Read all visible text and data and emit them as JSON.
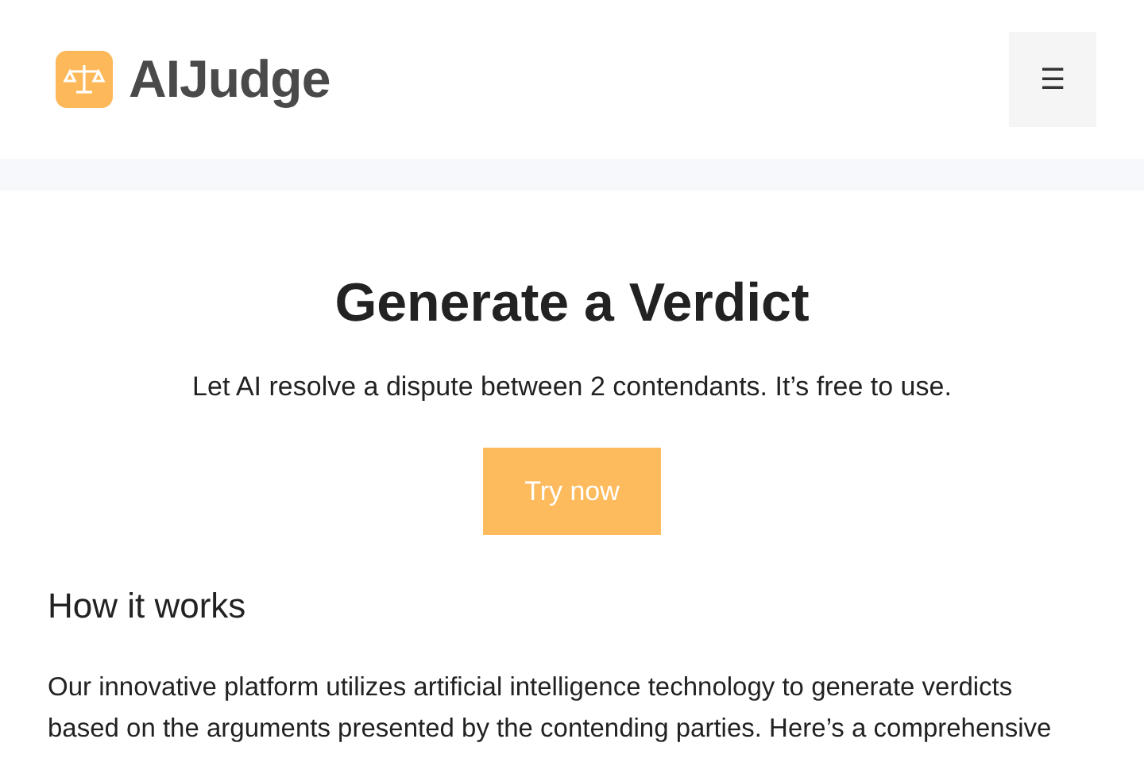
{
  "header": {
    "logo_text": "AIJudge",
    "menu_icon": "☰"
  },
  "hero": {
    "title": "Generate a Verdict",
    "subtitle": "Let AI resolve a dispute between 2 contendants. It’s free to use.",
    "button": "Try now"
  },
  "section": {
    "heading": "How it works",
    "paragraph": "Our innovative platform utilizes artificial intelligence technology to generate verdicts based on the arguments presented by the contending parties. Here’s a comprehensive"
  }
}
